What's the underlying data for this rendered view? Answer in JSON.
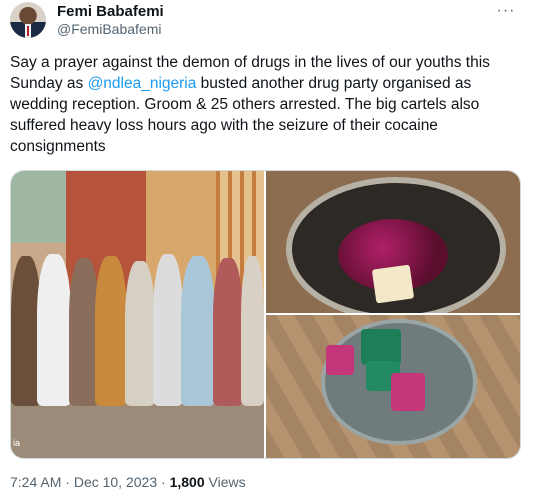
{
  "author": {
    "name": "Femi Babafemi",
    "handle": "@FemiBabafemi"
  },
  "more_icon": "more-horizontal-icon",
  "tweet": {
    "text_before": "Say a prayer against the demon of drugs in the lives of our youths this Sunday as ",
    "mention": "@ndlea_nigeria",
    "text_after": " busted another drug party organised as wedding reception. Groom & 25 others arrested. The big cartels also suffered heavy loss hours ago with the seizure of their cocaine consignments"
  },
  "media": {
    "watermark": "ia"
  },
  "meta": {
    "time": "7:24 AM",
    "separator": "·",
    "date": "Dec 10, 2023",
    "views_count": "1,800",
    "views_label": "Views"
  },
  "colors": {
    "text": "#0f1419",
    "secondary": "#536471",
    "link": "#1d9bf0",
    "border": "#cfd9de"
  }
}
